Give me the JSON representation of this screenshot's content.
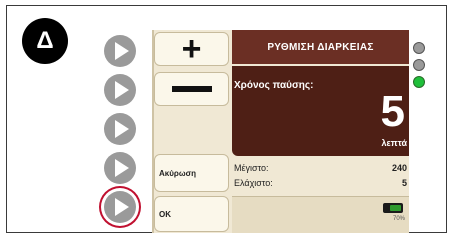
{
  "step": {
    "label": "Δ"
  },
  "device": {
    "header": {
      "title": "ΡΥΘΜΙΣΗ ΔΙΑΡΚΕΙΑΣ"
    },
    "pause": {
      "label": "Χρόνος παύσης:",
      "value": "5",
      "unit": "λεπτά"
    },
    "limits": {
      "max": {
        "label": "Μέγιστο:",
        "value": "240"
      },
      "min": {
        "label": "Ελάχιστο:",
        "value": "5"
      }
    },
    "battery": {
      "percent_label": "70%",
      "level": 0.7
    },
    "softkeys": {
      "plus_icon": "plus-icon",
      "minus_icon": "minus-icon",
      "cancel_label": "Ακύρωση",
      "ok_label": "ΟΚ"
    }
  },
  "leds": [
    {
      "state": "off",
      "color": "#9a9a9a"
    },
    {
      "state": "off",
      "color": "#9a9a9a"
    },
    {
      "state": "on",
      "color": "#1fbf3a"
    }
  ],
  "colors": {
    "header": "#6b2f24",
    "panel": "#4e1f15",
    "screen_bg": "#f0e8d4",
    "highlight_ring": "#c01030"
  }
}
